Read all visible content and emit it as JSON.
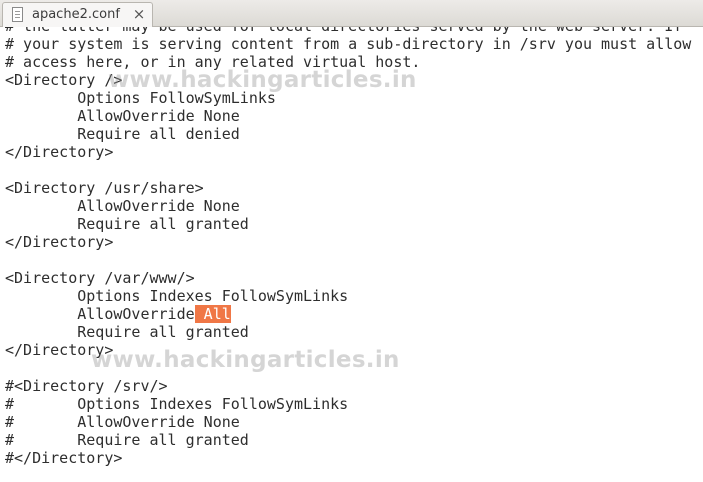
{
  "tab": {
    "title": "apache2.conf",
    "close_glyph": "×",
    "icon": "text-file-icon"
  },
  "editor": {
    "highlight_color": "#f07746",
    "lines": [
      {
        "text": "# the latter may be used for local directories served by the web server. If"
      },
      {
        "text": "# your system is serving content from a sub-directory in /srv you must allow"
      },
      {
        "text": "# access here, or in any related virtual host."
      },
      {
        "text": "<Directory />"
      },
      {
        "text": "        Options FollowSymLinks"
      },
      {
        "text": "        AllowOverride None"
      },
      {
        "text": "        Require all denied"
      },
      {
        "text": "</Directory>"
      },
      {
        "text": ""
      },
      {
        "text": "<Directory /usr/share>"
      },
      {
        "text": "        AllowOverride None"
      },
      {
        "text": "        Require all granted"
      },
      {
        "text": "</Directory>"
      },
      {
        "text": ""
      },
      {
        "text": "<Directory /var/www/>"
      },
      {
        "text": "        Options Indexes FollowSymLinks"
      },
      {
        "text": "        AllowOverride",
        "highlight": " All"
      },
      {
        "text": "        Require all granted"
      },
      {
        "text": "</Directory>"
      },
      {
        "text": ""
      },
      {
        "text": "#<Directory /srv/>"
      },
      {
        "text": "#       Options Indexes FollowSymLinks"
      },
      {
        "text": "#       AllowOverride None"
      },
      {
        "text": "#       Require all granted"
      },
      {
        "text": "#</Directory>"
      }
    ]
  },
  "watermark": {
    "text": "www.hackingarticles.in"
  }
}
